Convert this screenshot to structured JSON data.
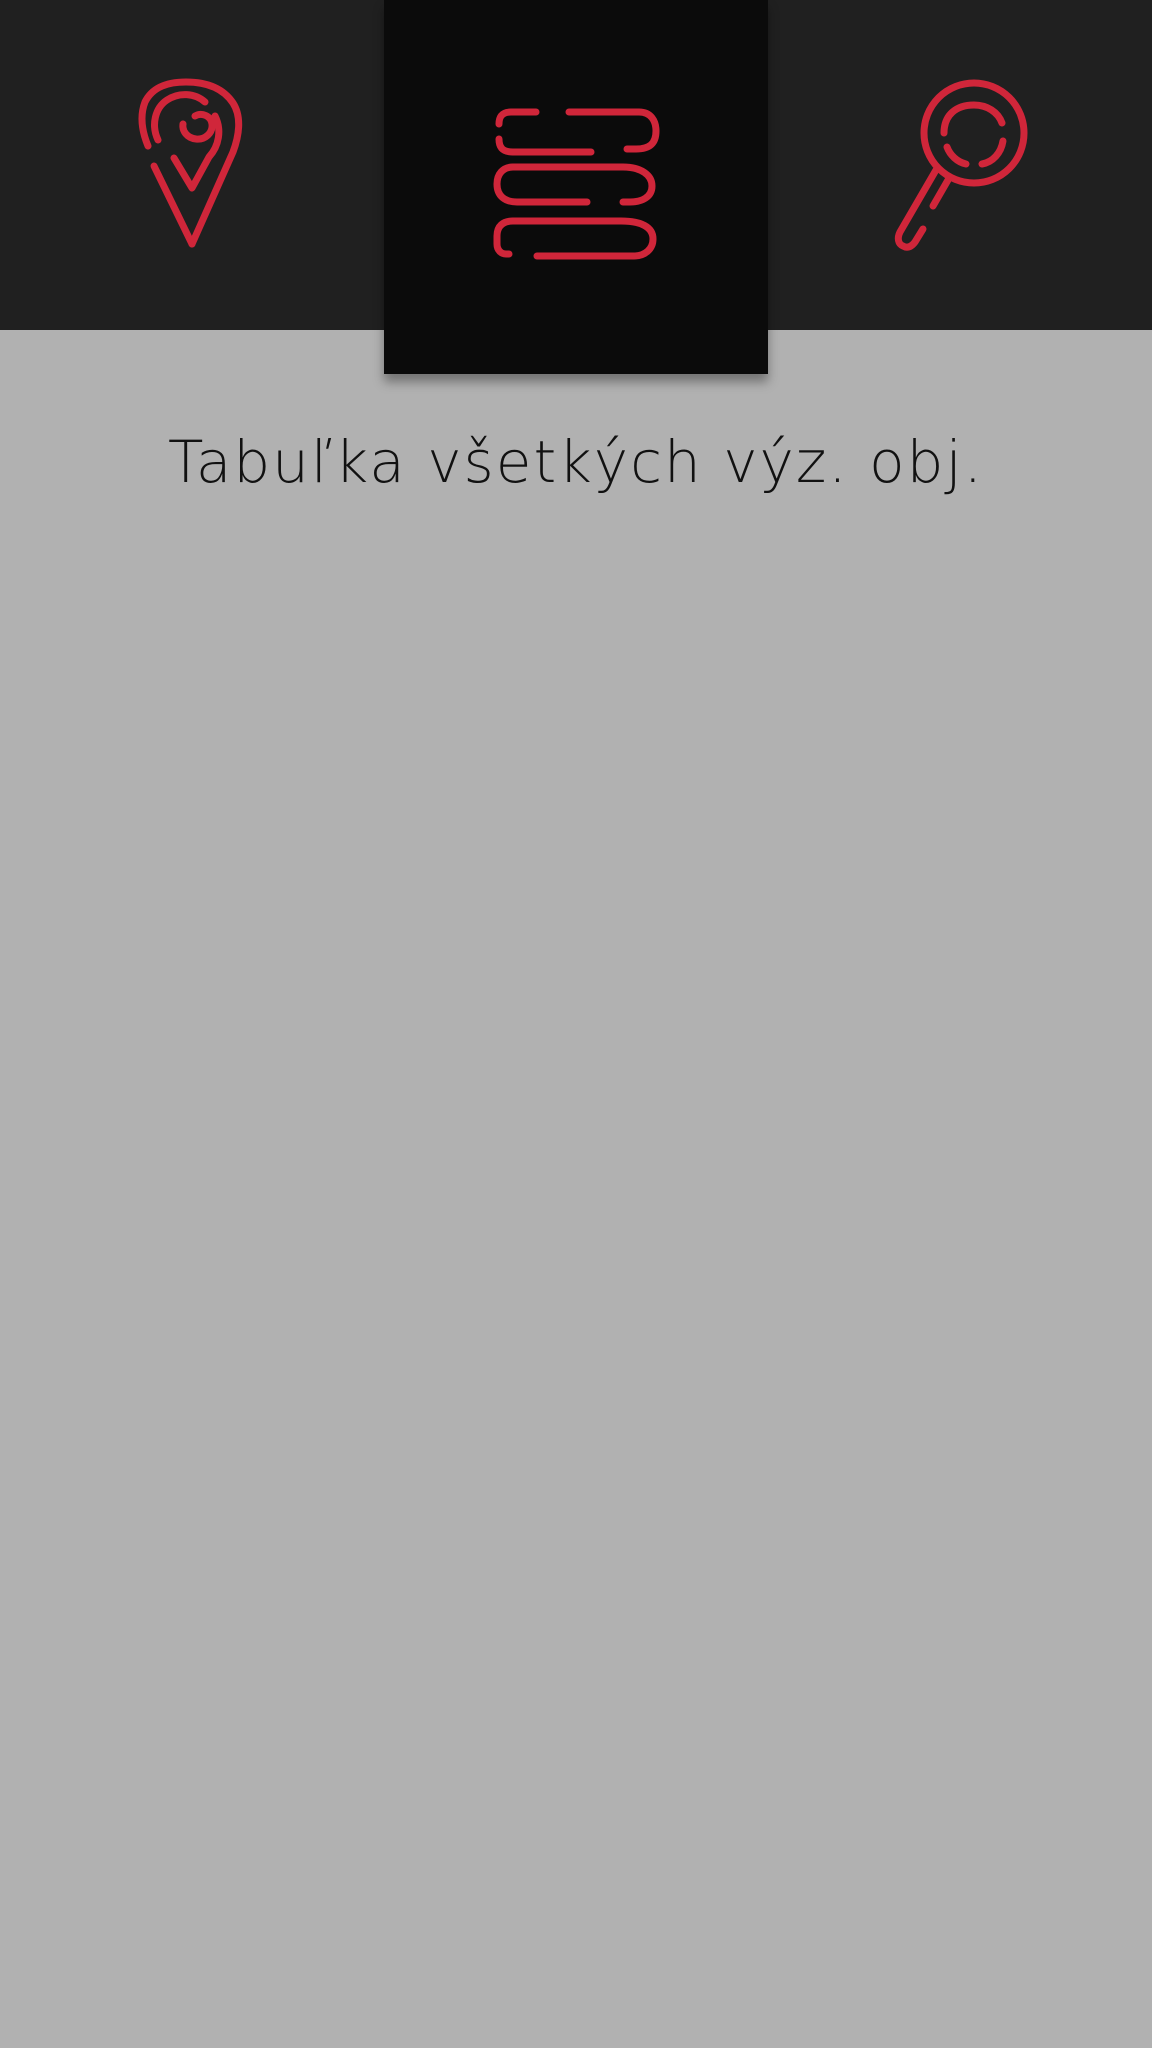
{
  "colors": {
    "accent": "#d0263a",
    "topbar_bg": "#202020",
    "active_tab_bg": "#0b0b0b",
    "content_bg": "#b1b1b1",
    "title_text": "#111111"
  },
  "navigation": {
    "tabs": [
      {
        "icon": "map-pin-icon",
        "active": false
      },
      {
        "icon": "list-stack-icon",
        "active": true
      },
      {
        "icon": "search-icon",
        "active": false
      }
    ]
  },
  "main": {
    "title": "Tabuľka všetkých výz. obj."
  }
}
